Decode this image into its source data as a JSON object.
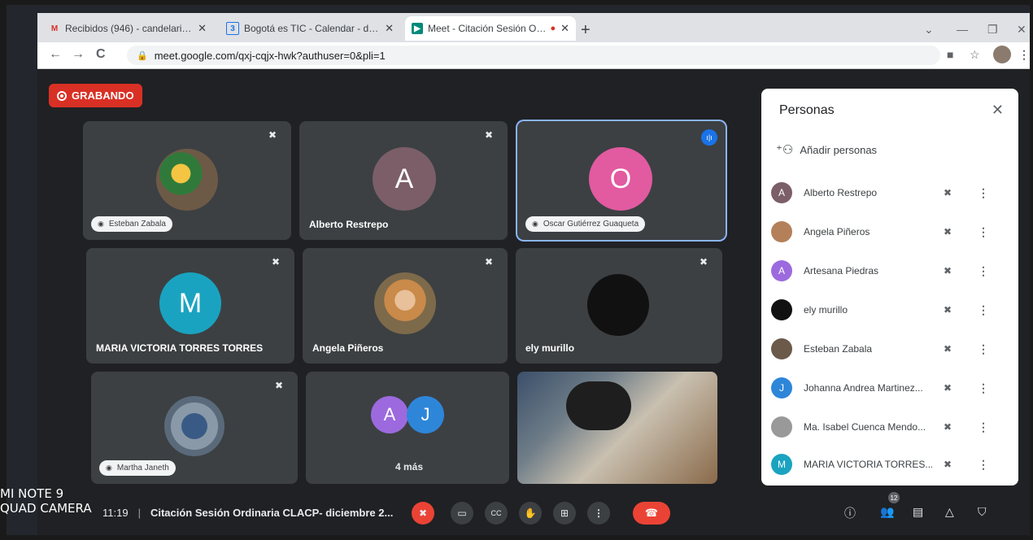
{
  "browser": {
    "tabs": [
      {
        "label": "Recibidos (946) - candelaria@scr",
        "icon": "gmail-icon"
      },
      {
        "label": "Bogotá es TIC - Calendar - dicien",
        "icon": "calendar-icon"
      },
      {
        "label": "Meet - Citación Sesión Ordin",
        "icon": "meet-icon",
        "active": true
      }
    ],
    "new_tab": "+",
    "url": "meet.google.com/qxj-cqjx-hwk?authuser=0&pli=1"
  },
  "meet": {
    "recording_label": "GRABANDO",
    "tiles": [
      {
        "name": "Esteban Zabala",
        "pinned_label": true
      },
      {
        "name": "Alberto Restrepo",
        "initial": "A",
        "color": "#7b5e68"
      },
      {
        "name": "Oscar Gutiérrez Guaqueta",
        "initial": "O",
        "color": "#e25aa0",
        "pinned_label": true,
        "speaking": true
      },
      {
        "name": "MARIA VICTORIA TORRES TORRES",
        "initial": "M",
        "color": "#1aa3c0"
      },
      {
        "name": "Angela Piñeros"
      },
      {
        "name": "ely murillo",
        "color": "#111111"
      },
      {
        "name": "Martha Janeth",
        "pinned_label": true
      },
      {
        "initials": [
          "A",
          "J"
        ],
        "colors": [
          "#9c6ade",
          "#2e86d9"
        ],
        "more_label": "4 más"
      }
    ],
    "people_panel": {
      "title": "Personas",
      "add_label": "Añadir personas",
      "participants": [
        {
          "name": "Alberto Restrepo",
          "initial": "A",
          "color": "#7b5e68"
        },
        {
          "name": "Angela Piñeros",
          "initial": "",
          "color": "#b3805a"
        },
        {
          "name": "Artesana Piedras",
          "initial": "A",
          "color": "#9c6ade"
        },
        {
          "name": "ely murillo",
          "initial": "",
          "color": "#111111"
        },
        {
          "name": "Esteban Zabala",
          "initial": "",
          "color": "#6b5a4a"
        },
        {
          "name": "Johanna Andrea Martinez...",
          "initial": "J",
          "color": "#2e86d9"
        },
        {
          "name": "Ma. Isabel Cuenca Mendo...",
          "initial": "",
          "color": "#999999"
        },
        {
          "name": "MARIA VICTORIA TORRES...",
          "initial": "M",
          "color": "#1aa3c0"
        }
      ]
    },
    "bottom": {
      "time": "11:19",
      "meeting_title": "Citación Sesión Ordinaria CLACP- diciembre 2...",
      "participant_count": "12"
    }
  },
  "watermark": {
    "line1": "MI NOTE 9",
    "line2": "QUAD CAMERA"
  },
  "accent": "#d93025"
}
